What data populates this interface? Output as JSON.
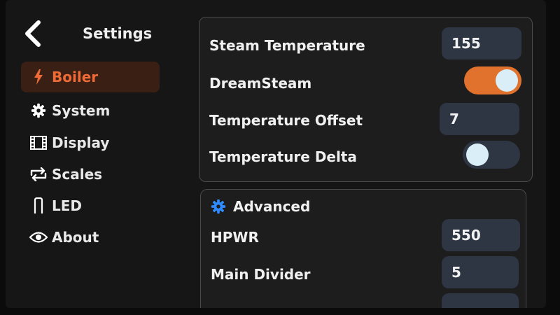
{
  "header": {
    "title": "Settings"
  },
  "sidebar": {
    "items": [
      {
        "label": "Boiler",
        "icon": "lightning-icon",
        "active": true
      },
      {
        "label": "System",
        "icon": "gear-icon",
        "active": false
      },
      {
        "label": "Display",
        "icon": "film-icon",
        "active": false
      },
      {
        "label": "Scales",
        "icon": "repeat-arrows-icon",
        "active": false
      },
      {
        "label": "LED",
        "icon": "lamp-icon",
        "active": false
      },
      {
        "label": "About",
        "icon": "eye-icon",
        "active": false
      }
    ]
  },
  "boiler": {
    "steam_temperature": {
      "label": "Steam Temperature",
      "value": "155"
    },
    "dreamsteam": {
      "label": "DreamSteam",
      "enabled": true
    },
    "temperature_offset": {
      "label": "Temperature Offset",
      "value": "7"
    },
    "temperature_delta": {
      "label": "Temperature Delta",
      "enabled": false
    }
  },
  "advanced": {
    "title": "Advanced",
    "hpwr": {
      "label": "HPWR",
      "value": "550"
    },
    "main_divider": {
      "label": "Main Divider",
      "value": "5"
    }
  },
  "colors": {
    "accent": "#e0722d",
    "active_text": "#ee6b37",
    "field_bg": "#2e3543",
    "icon_blue": "#2f8cff"
  }
}
